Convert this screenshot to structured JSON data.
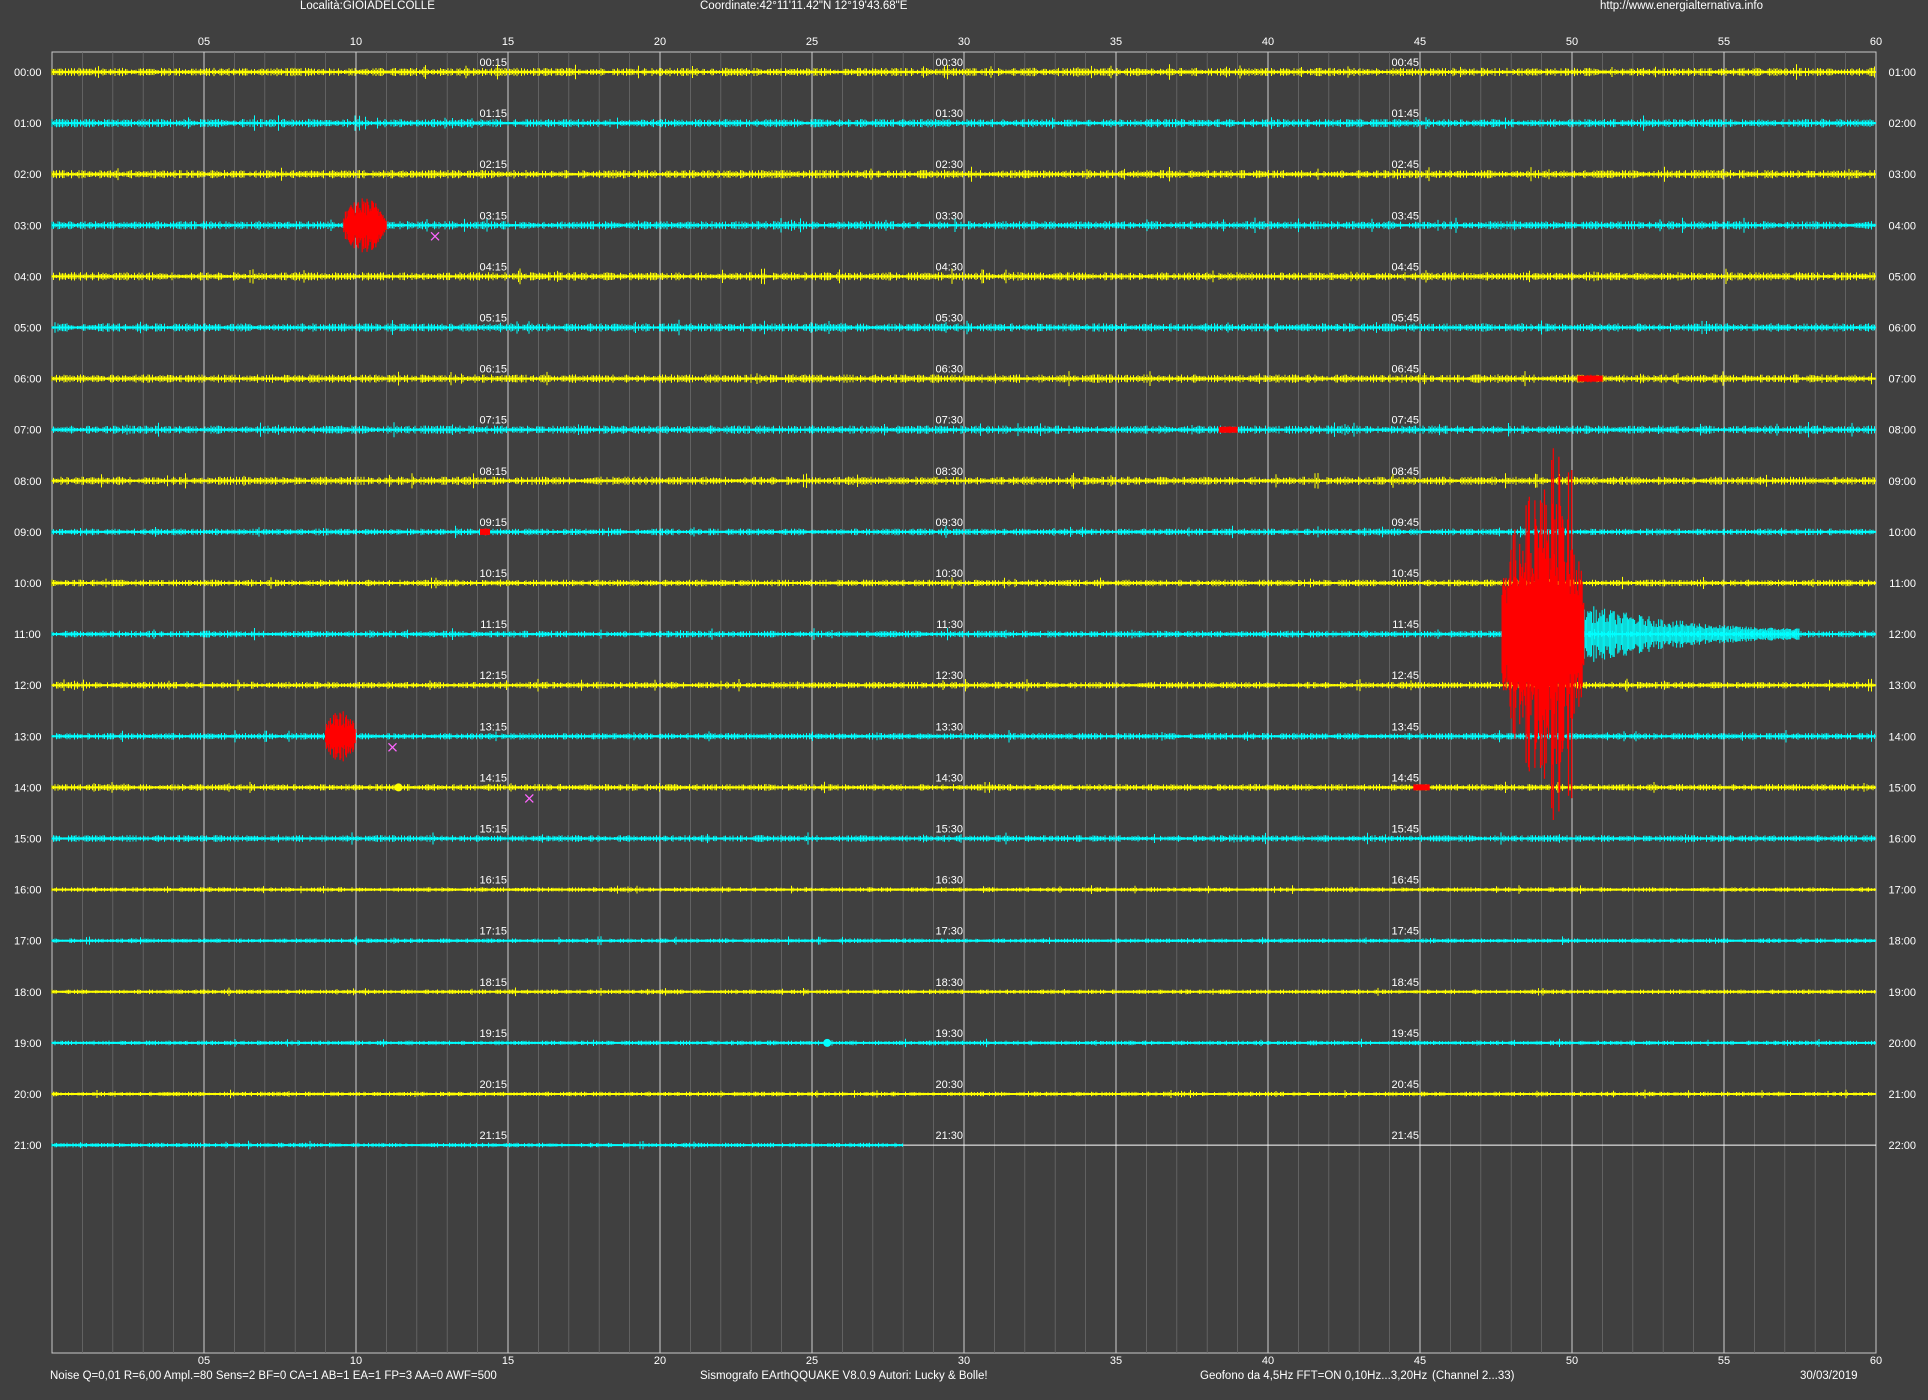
{
  "header": {
    "location": "Località:GIOIADELCOLLE",
    "coordinates": "Coordinate:42°11'11.42\"N  12°19'43.68\"E",
    "website": "http://www.energialternativa.info"
  },
  "footer": {
    "params": "Noise Q=0,01 R=6,00 Ampl.=80 Sens=2 BF=0 CA=1 AB=1 EA=1 FP=3 AA=0 AWF=500",
    "software": "Sismografo EArthQQUAKE  V8.0.9  Autori: Lucky & Bolle!",
    "geofono": "Geofono da 4,5Hz FFT=ON 0,10Hz...3,20Hz",
    "channel": "(Channel 2...33)",
    "date": "30/03/2019"
  },
  "colors": {
    "background": "#404040",
    "trace_a": "#ffff00",
    "trace_b": "#00ffff",
    "event": "#ff0000",
    "marker": "#ff66ff",
    "grid": "#c8c8c8"
  },
  "chart_data": {
    "type": "line",
    "x_ticks": [
      "05",
      "10",
      "15",
      "20",
      "25",
      "30",
      "35",
      "40",
      "45",
      "50",
      "55",
      "60"
    ],
    "xlim": [
      0,
      60
    ],
    "left_labels": [
      "00:00",
      "01:00",
      "02:00",
      "03:00",
      "04:00",
      "05:00",
      "06:00",
      "07:00",
      "08:00",
      "09:00",
      "10:00",
      "11:00",
      "12:00",
      "13:00",
      "14:00",
      "15:00",
      "16:00",
      "17:00",
      "18:00",
      "19:00",
      "20:00",
      "21:00"
    ],
    "right_labels": [
      "01:00",
      "02:00",
      "03:00",
      "04:00",
      "05:00",
      "06:00",
      "07:00",
      "08:00",
      "09:00",
      "10:00",
      "11:00",
      "12:00",
      "13:00",
      "14:00",
      "15:00",
      "16:00",
      "17:00",
      "18:00",
      "19:00",
      "20:00",
      "21:00",
      "22:00"
    ],
    "quarter_labels": [
      [
        "00:15",
        "00:30",
        "00:45"
      ],
      [
        "01:15",
        "01:30",
        "01:45"
      ],
      [
        "02:15",
        "02:30",
        "02:45"
      ],
      [
        "03:15",
        "03:30",
        "03:45"
      ],
      [
        "04:15",
        "04:30",
        "04:45"
      ],
      [
        "05:15",
        "05:30",
        "05:45"
      ],
      [
        "06:15",
        "06:30",
        "06:45"
      ],
      [
        "07:15",
        "07:30",
        "07:45"
      ],
      [
        "08:15",
        "08:30",
        "08:45"
      ],
      [
        "09:15",
        "09:30",
        "09:45"
      ],
      [
        "10:15",
        "10:30",
        "10:45"
      ],
      [
        "11:15",
        "11:30",
        "11:45"
      ],
      [
        "12:15",
        "12:30",
        "12:45"
      ],
      [
        "13:15",
        "13:30",
        "13:45"
      ],
      [
        "14:15",
        "14:30",
        "14:45"
      ],
      [
        "15:15",
        "15:30",
        "15:45"
      ],
      [
        "16:15",
        "16:30",
        "16:45"
      ],
      [
        "17:15",
        "17:30",
        "17:45"
      ],
      [
        "18:15",
        "18:30",
        "18:45"
      ],
      [
        "19:15",
        "19:30",
        "19:45"
      ],
      [
        "20:15",
        "20:30",
        "20:45"
      ],
      [
        "21:15",
        "21:30",
        "21:45"
      ]
    ],
    "trace_end_last_row_min": 28,
    "events": [
      {
        "row": 3,
        "start_min": 9.6,
        "end_min": 11.0,
        "amp": 28
      },
      {
        "row": 6,
        "start_min": 50.2,
        "end_min": 51.0,
        "amp": 4
      },
      {
        "row": 7,
        "start_min": 38.4,
        "end_min": 39.0,
        "amp": 4
      },
      {
        "row": 9,
        "start_min": 14.1,
        "end_min": 14.4,
        "amp": 4
      },
      {
        "row": 11,
        "start_min": 47.7,
        "end_min": 50.4,
        "amp": 150
      },
      {
        "row": 13,
        "start_min": 9.0,
        "end_min": 10.0,
        "amp": 26
      },
      {
        "row": 14,
        "start_min": 44.8,
        "end_min": 45.3,
        "amp": 4
      }
    ],
    "coda": [
      {
        "row": 11,
        "start_min": 50.4,
        "end_min": 57.5,
        "amp": 28
      }
    ],
    "markers": [
      {
        "row": 3,
        "min": 12.6
      },
      {
        "row": 13,
        "min": 11.2
      },
      {
        "row": 14,
        "min": 15.7
      }
    ],
    "blips": [
      {
        "row": 14,
        "min": 11.4,
        "color": "trace_a"
      },
      {
        "row": 19,
        "min": 25.5,
        "color": "trace_b"
      }
    ]
  }
}
